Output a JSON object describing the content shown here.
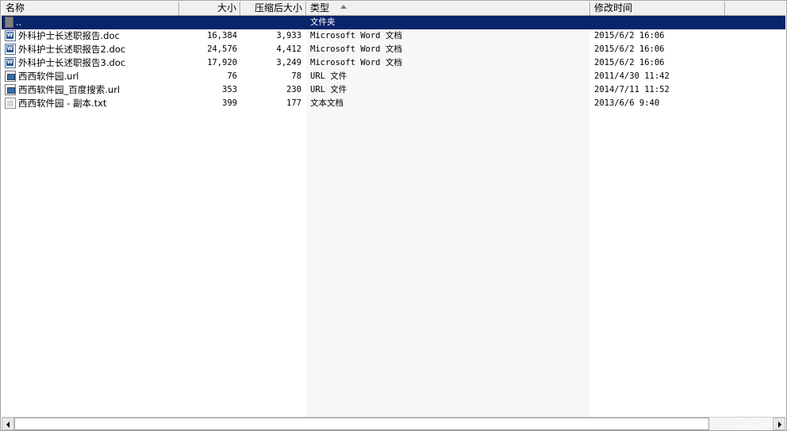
{
  "columns": {
    "name": "名称",
    "size": "大小",
    "compressed": "压缩后大小",
    "type": "类型",
    "modified": "修改时间"
  },
  "sort": {
    "column": "type",
    "direction": "ascending"
  },
  "rows": [
    {
      "icon": "folder-up-icon",
      "name": "..",
      "size": "",
      "compressed": "",
      "type": "文件夹",
      "modified": "",
      "selected": true
    },
    {
      "icon": "word-doc-icon",
      "name": "外科护士长述职报告.doc",
      "size": "16,384",
      "compressed": "3,933",
      "type": "Microsoft Word 文档",
      "modified": "2015/6/2 16:06"
    },
    {
      "icon": "word-doc-icon",
      "name": "外科护士长述职报告2.doc",
      "size": "24,576",
      "compressed": "4,412",
      "type": "Microsoft Word 文档",
      "modified": "2015/6/2 16:06"
    },
    {
      "icon": "word-doc-icon",
      "name": "外科护士长述职报告3.doc",
      "size": "17,920",
      "compressed": "3,249",
      "type": "Microsoft Word 文档",
      "modified": "2015/6/2 16:06"
    },
    {
      "icon": "url-file-icon",
      "name": "西西软件园.url",
      "size": "76",
      "compressed": "78",
      "type": "URL 文件",
      "modified": "2011/4/30 11:42"
    },
    {
      "icon": "url-file-icon",
      "name": "西西软件园_百度搜索.url",
      "size": "353",
      "compressed": "230",
      "type": "URL 文件",
      "modified": "2014/7/11 11:52"
    },
    {
      "icon": "text-file-icon",
      "name": "西西软件园 - 副本.txt",
      "size": "399",
      "compressed": "177",
      "type": "文本文档",
      "modified": "2013/6/6 9:40"
    }
  ],
  "colors": {
    "selection": "#0a246a",
    "sorted_column_tint": "#f7f7f7"
  }
}
